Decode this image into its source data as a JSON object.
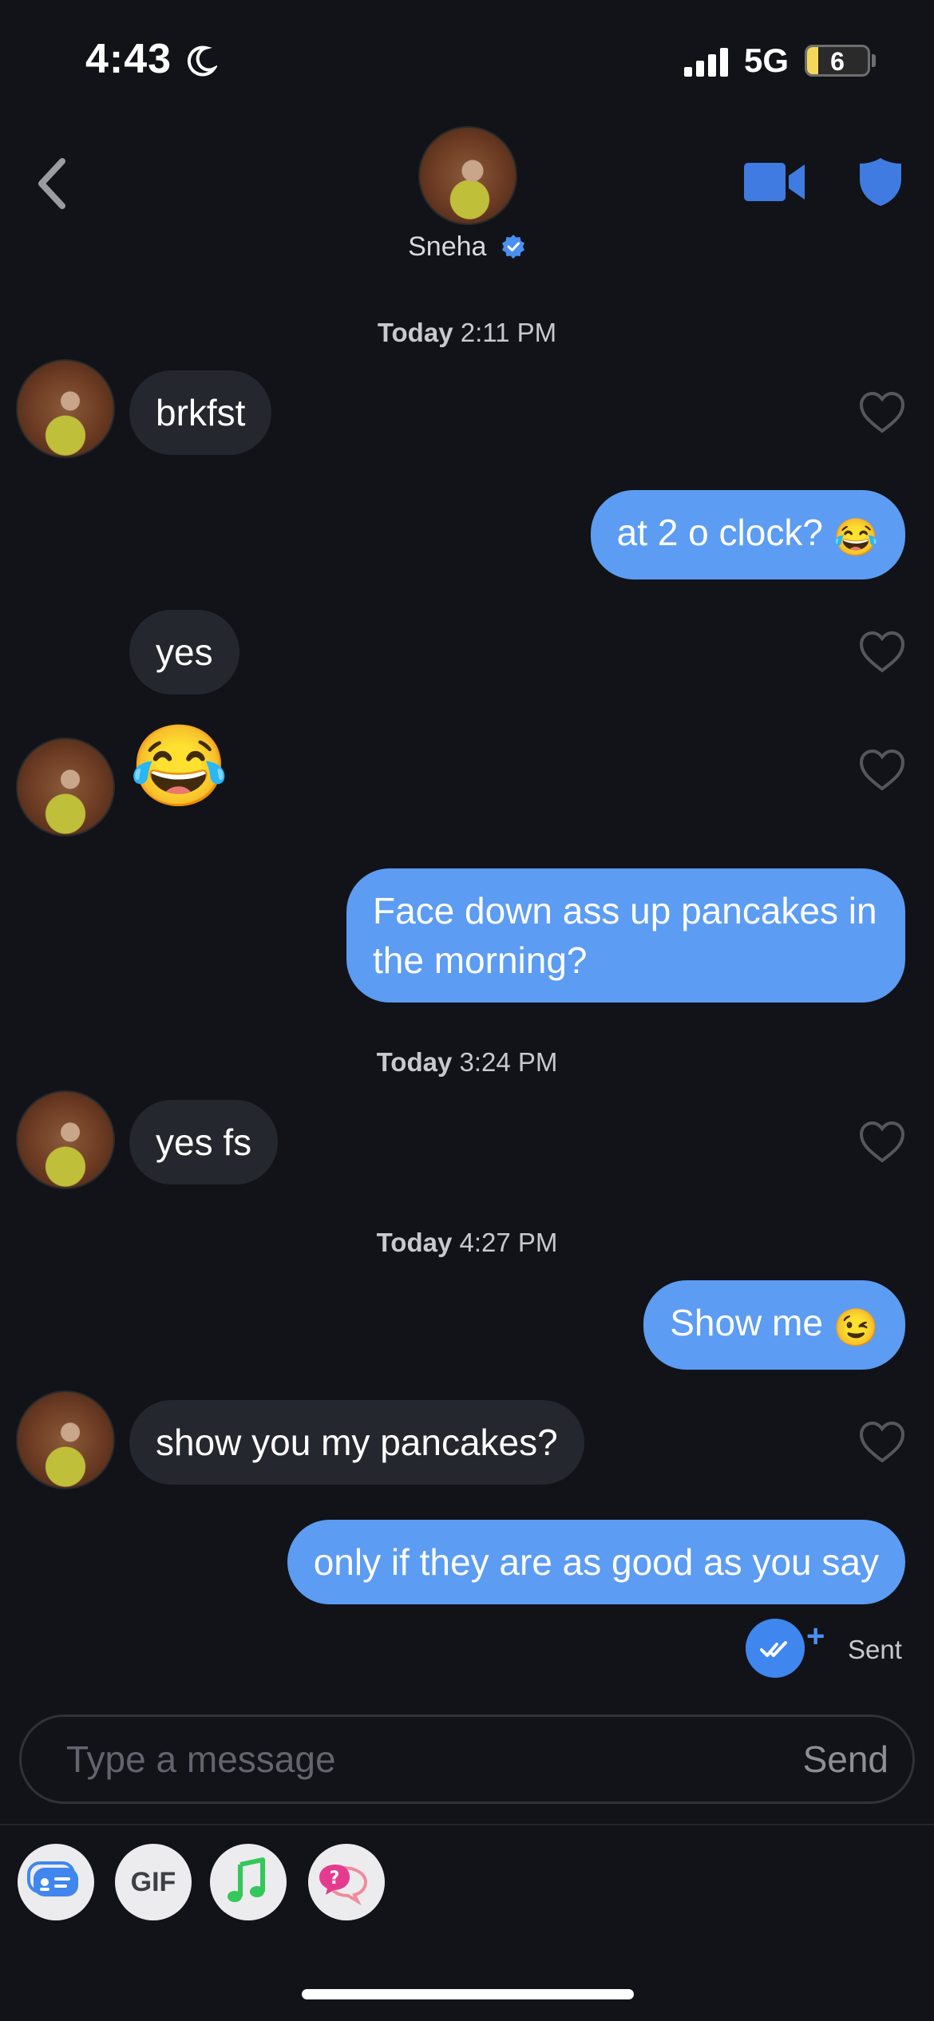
{
  "status_bar": {
    "time": "4:43",
    "network": "5G",
    "battery_level": "6",
    "battery_fraction": 0.06
  },
  "header": {
    "contact_name": "Sneha"
  },
  "conversation": {
    "timestamps": [
      {
        "day": "Today",
        "time": "2:11 PM"
      },
      {
        "day": "Today",
        "time": "3:24 PM"
      },
      {
        "day": "Today",
        "time": "4:27 PM"
      }
    ],
    "messages": [
      {
        "direction": "received",
        "text": "brkfst"
      },
      {
        "direction": "sent",
        "text": "at 2 o clock?",
        "emoji": "😂"
      },
      {
        "direction": "received",
        "text": "yes"
      },
      {
        "direction": "received",
        "text": "😂"
      },
      {
        "direction": "sent",
        "text": "Face down ass up pancakes in the morning?"
      },
      {
        "direction": "received",
        "text": "yes fs"
      },
      {
        "direction": "sent",
        "text": "Show me",
        "emoji": "😉"
      },
      {
        "direction": "received",
        "text": "show you my pancakes?"
      },
      {
        "direction": "sent",
        "text": "only if they are as good as you say"
      }
    ],
    "delivery_status": "Sent"
  },
  "composer": {
    "placeholder": "Type a message",
    "send_label": "Send"
  },
  "toolbar": {
    "gif_label": "GIF",
    "icons": [
      "profile-card-icon",
      "gif-icon",
      "music-note-icon",
      "question-bubbles-icon"
    ]
  },
  "colors": {
    "background": "#111318",
    "sent_bubble": "#5c9cf2",
    "received_bubble": "#24272e",
    "accent": "#3f7be0"
  }
}
